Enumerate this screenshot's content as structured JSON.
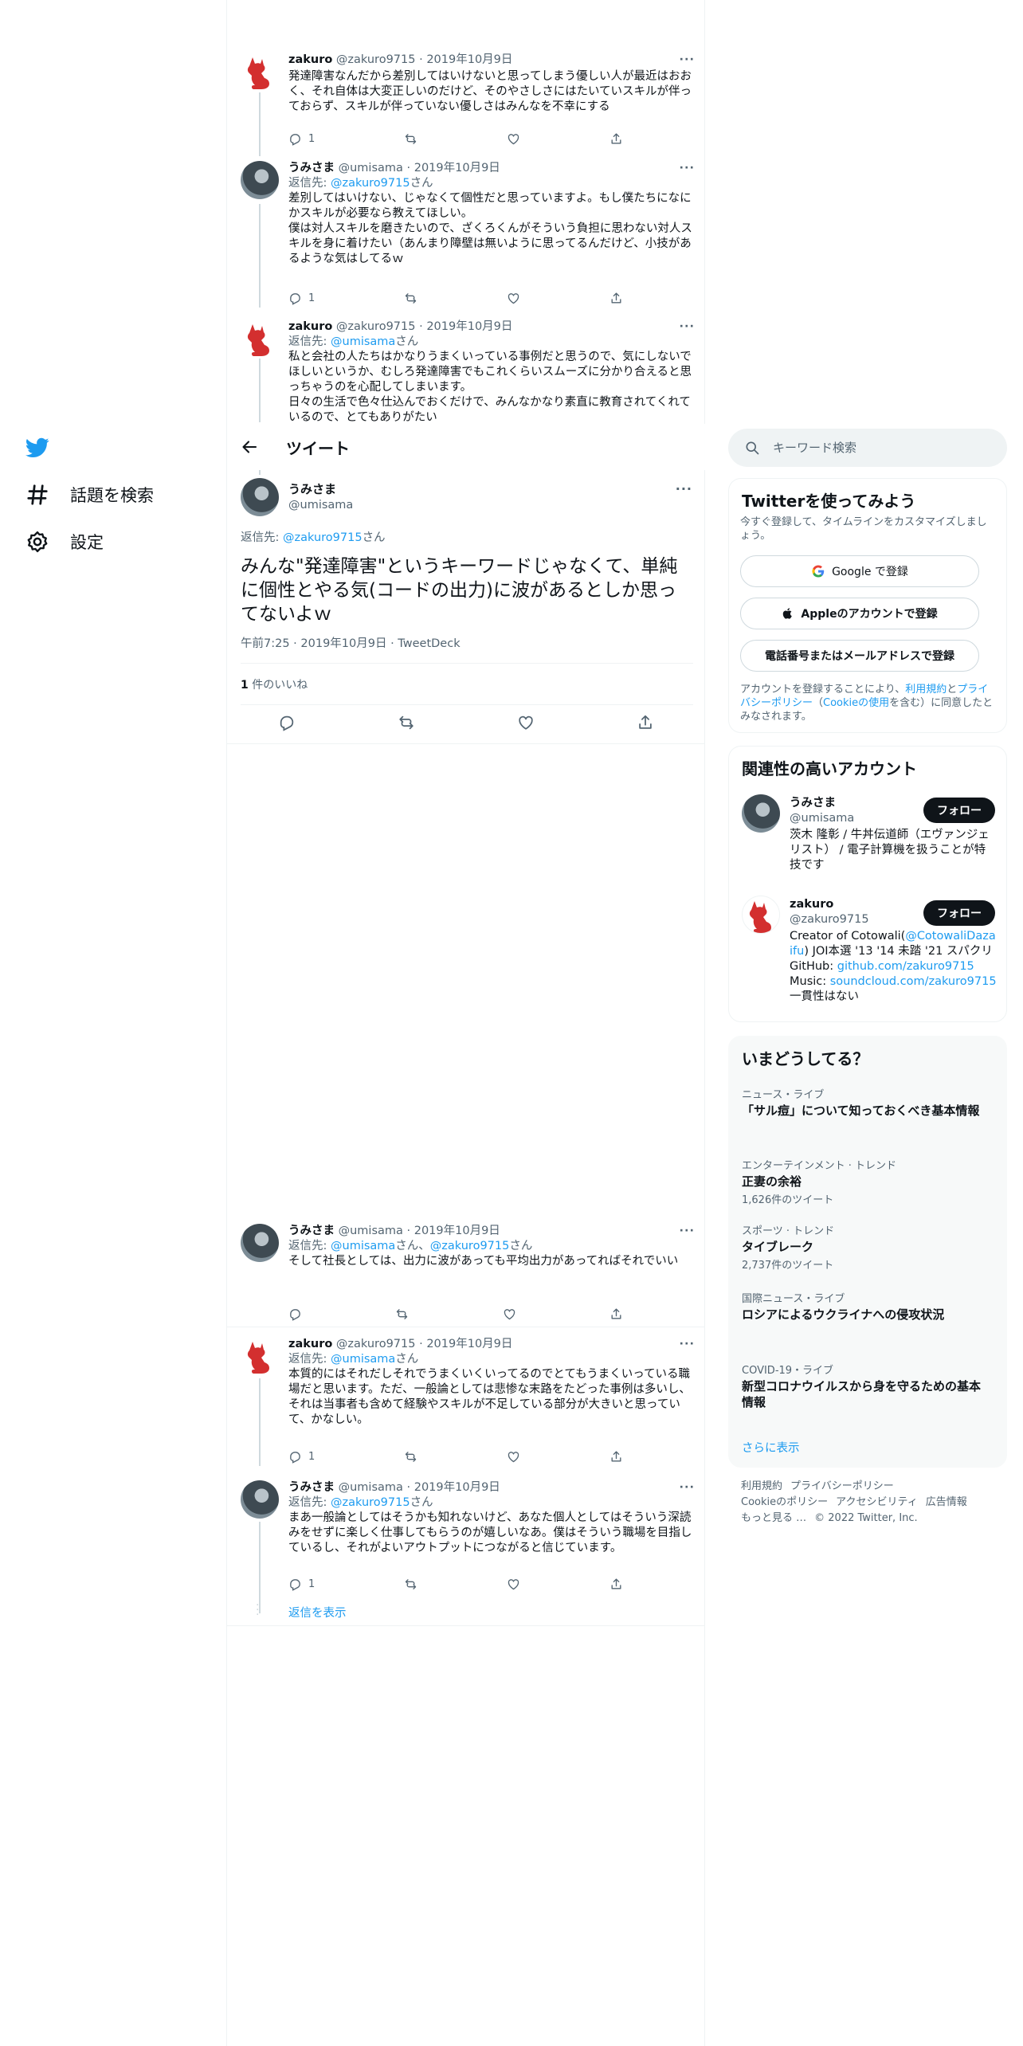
{
  "nav": {
    "explore_label": "話題を検索",
    "settings_label": "設定"
  },
  "header": {
    "title": "ツイート"
  },
  "thread_top": [
    {
      "name": "zakuro",
      "handle": "@zakuro9715",
      "date": "2019年10月9日",
      "text": "発達障害なんだから差別してはいけないと思ってしまう優しい人が最近はおおく、それ自体は大変正しいのだけど、そのやさしさにはたいていスキルが伴っておらず、スキルが伴っていない優しさはみんなを不幸にする",
      "reply_count": "1"
    },
    {
      "name": "うみさま",
      "handle": "@umisama",
      "date": "2019年10月9日",
      "reply_prefix": "返信先: ",
      "reply_to": "@zakuro9715",
      "reply_suffix": "さん",
      "text": "差別してはいけない、じゃなくて個性だと思っていますよ。もし僕たちになにかスキルが必要なら教えてほしい。\n僕は対人スキルを磨きたいので、ざくろくんがそういう負担に思わない対人スキルを身に着けたい（あんまり障壁は無いように思ってるんだけど、小技があるような気はしてるｗ",
      "reply_count": "1"
    },
    {
      "name": "zakuro",
      "handle": "@zakuro9715",
      "date": "2019年10月9日",
      "reply_prefix": "返信先: ",
      "reply_to": "@umisama",
      "reply_suffix": "さん",
      "text": "私と会社の人たちはかなりうまくいっている事例だと思うので、気にしないでほしいというか、むしろ発達障害でもこれくらいスムーズに分かり合えると思っちゃうのを心配してしまいます。\n日々の生活で色々仕込んでおくだけで、みんなかなり素直に教育されてくれているので、とてもありがたい"
    }
  ],
  "main_tweet": {
    "name": "うみさま",
    "handle": "@umisama",
    "reply_prefix": "返信先: ",
    "reply_to": "@zakuro9715",
    "reply_suffix": "さん",
    "text": "みんな\"発達障害\"というキーワードじゃなくて、単純に個性とやる気(コードの出力)に波があるとしか思ってないよｗ",
    "time": "午前7:25",
    "date": "2019年10月9日",
    "client": "TweetDeck",
    "likes_count": "1",
    "likes_label": " 件のいいね"
  },
  "replies": [
    {
      "name": "うみさま",
      "handle": "@umisama",
      "date": "2019年10月9日",
      "reply_prefix": "返信先: ",
      "reply_to": "@umisama",
      "reply_mid": "さん、",
      "reply_to2": "@zakuro9715",
      "reply_suffix": "さん",
      "text": "そして社長としては、出力に波があっても平均出力があってればそれでいい"
    },
    {
      "name": "zakuro",
      "handle": "@zakuro9715",
      "date": "2019年10月9日",
      "reply_prefix": "返信先: ",
      "reply_to": "@umisama",
      "reply_suffix": "さん",
      "text": "本質的にはそれだしそれでうまくいくいってるのでとてもうまくいっている職場だと思います。ただ、一般論としては悲惨な末路をたどった事例は多いし、それは当事者も含めて経験やスキルが不足している部分が大きいと思っていて、かなしい。",
      "reply_count": "1"
    },
    {
      "name": "うみさま",
      "handle": "@umisama",
      "date": "2019年10月9日",
      "reply_prefix": "返信先: ",
      "reply_to": "@zakuro9715",
      "reply_suffix": "さん",
      "text": "まあ一般論としてはそうかも知れないけど、あなた個人としてはそういう深読みをせずに楽しく仕事してもらうのが嬉しいなあ。僕はそういう職場を目指しているし、それがよいアウトプットにつながると信じています。",
      "reply_count": "1"
    }
  ],
  "show_replies_label": "返信を表示",
  "search": {
    "placeholder": "キーワード検索"
  },
  "signup": {
    "title": "Twitterを使ってみよう",
    "subtitle": "今すぐ登録して、タイムラインをカスタマイズしましょう。",
    "google_label": "Google で登録",
    "apple_label": "Appleのアカウントで登録",
    "phone_label": "電話番号またはメールアドレスで登録",
    "terms_prefix": "アカウントを登録することにより、",
    "terms_link": "利用規約",
    "terms_and": "と",
    "privacy_link": "プライバシーポリシー",
    "cookie_prefix": "（",
    "cookie_link": "Cookieの使用",
    "terms_suffix": "を含む）に同意したとみなされます。"
  },
  "related": {
    "title": "関連性の高いアカウント",
    "follow_label": "フォロー",
    "accounts": [
      {
        "name": "うみさま",
        "handle": "@umisama",
        "bio": "茨木 隆彰 / 牛丼伝道師（エヴァンジェリスト） / 電子計算機を扱うことが特技です"
      },
      {
        "name": "zakuro",
        "handle": "@zakuro9715",
        "bio_1": "Creator of Cotowali(",
        "bio_link1": "@CotowaliDazaifu",
        "bio_2": ") JOI本選 '13 '14 未踏 '21 スパクリ",
        "bio_3": "GitHub: ",
        "bio_link2": "github.com/zakuro9715",
        "bio_4": "Music: ",
        "bio_link3": "soundcloud.com/zakuro9715",
        "bio_5": "一貫性はない"
      }
    ]
  },
  "trends": {
    "title": "いまどうしてる？",
    "items": [
      {
        "category": "ニュース・ライブ",
        "title": "「サル痘」について知っておくべき基本情報",
        "count": ""
      },
      {
        "category": "エンターテインメント · トレンド",
        "title": "正妻の余裕",
        "count": "1,626件のツイート"
      },
      {
        "category": "スポーツ · トレンド",
        "title": "タイブレーク",
        "count": "2,737件のツイート"
      },
      {
        "category": "国際ニュース・ライブ",
        "title": "ロシアによるウクライナへの侵攻状況",
        "count": ""
      },
      {
        "category": "COVID-19・ライブ",
        "title": "新型コロナウイルスから身を守るための基本情報",
        "count": ""
      }
    ],
    "show_more": "さらに表示"
  },
  "footer": {
    "terms": "利用規約",
    "privacy": "プライバシーポリシー",
    "cookie": "Cookieのポリシー",
    "accessibility": "アクセシビリティ",
    "ads": "広告情報",
    "more": "もっと見る …",
    "copyright": "© 2022 Twitter, Inc."
  },
  "colors": {
    "accent": "#1d9bf0",
    "text": "#0f1419",
    "muted": "#536471",
    "border": "#eff3f4"
  }
}
